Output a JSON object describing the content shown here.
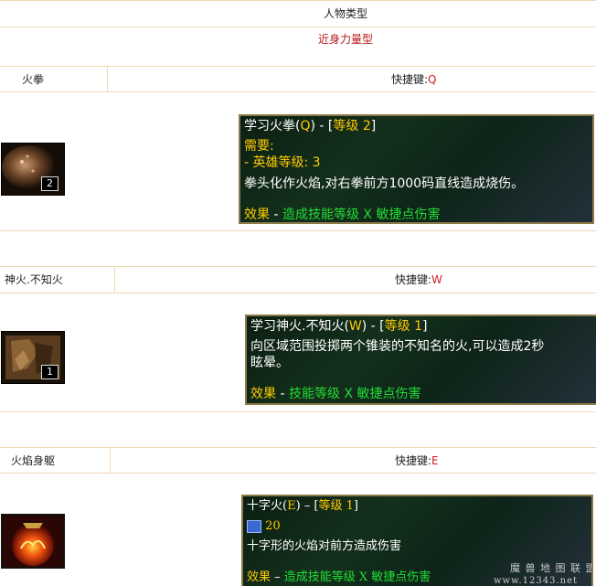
{
  "header": {
    "type_label": "人物类型",
    "type_value": "近身力量型"
  },
  "skills": [
    {
      "name": "火拳",
      "hotkey_label": "快捷键:",
      "hotkey": "Q",
      "icon_level": "2",
      "tooltip": {
        "title_pre": "学习火拳(",
        "title_key": "Q",
        "title_mid": ") - [",
        "title_level": "等级 2",
        "title_post": "]",
        "require_label": "需要:",
        "require_value": " - 英雄等级: 3",
        "desc": "拳头化作火焰,对右拳前方1000码直线造成烧伤。",
        "effect_label": "效果",
        "effect_sep": " - ",
        "effect_value": "造成技能等级 X 敏捷点伤害"
      }
    },
    {
      "name": "神火.不知火",
      "hotkey_label": "快捷键:",
      "hotkey": "W",
      "icon_level": "1",
      "tooltip": {
        "title_pre": "学习神火.不知火(",
        "title_key": "W",
        "title_mid": ") - [",
        "title_level": "等级 1",
        "title_post": "]",
        "desc_line1": "向区域范围投掷两个锥装的不知名的火,可以造成2秒",
        "desc_line2": "眩晕。",
        "effect_label": "效果",
        "effect_sep": " - ",
        "effect_value": "技能等级 X 敏捷点伤害"
      }
    },
    {
      "name": "火焰身躯",
      "hotkey_label": "快捷键:",
      "hotkey": "E",
      "tooltip": {
        "title_pre": "十字火(",
        "title_key": "E",
        "title_mid": ") – [",
        "title_level": "等级 1",
        "title_post": "]",
        "mana_cost": "20",
        "desc": "十字形的火焰对前方造成伤害",
        "effect_label": "效果",
        "effect_sep": " – ",
        "effect_value": "造成技能等级 X 敏捷点伤害"
      }
    }
  ],
  "watermark": {
    "line1": "魔 兽 地 图 联 盟",
    "line2": "www.12343.net"
  },
  "colors": {
    "border": "#f0d8b4",
    "hotkey": "#d01c1c",
    "type_value": "#b81414",
    "tooltip_yellow": "#ffcc00",
    "tooltip_green": "#22dd33"
  }
}
